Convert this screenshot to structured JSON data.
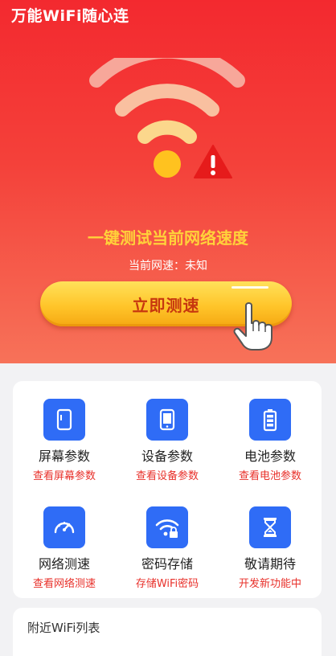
{
  "app": {
    "title": "万能WiFi随心连"
  },
  "hero": {
    "headline": "一键测试当前网络速度",
    "speed_line": "当前网速：未知",
    "test_button": "立即测速"
  },
  "features": [
    {
      "title": "屏幕参数",
      "sub": "查看屏幕参数",
      "icon": "phone-screen-icon"
    },
    {
      "title": "设备参数",
      "sub": "查看设备参数",
      "icon": "device-icon"
    },
    {
      "title": "电池参数",
      "sub": "查看电池参数",
      "icon": "battery-icon"
    },
    {
      "title": "网络测速",
      "sub": "查看网络测速",
      "icon": "speedometer-icon"
    },
    {
      "title": "密码存储",
      "sub": "存储WiFi密码",
      "icon": "wifi-lock-icon"
    },
    {
      "title": "敬请期待",
      "sub": "开发新功能中",
      "icon": "hourglass-icon"
    }
  ],
  "wifi_list": {
    "title": "附近WiFi列表"
  },
  "colors": {
    "accent_red": "#f3292f",
    "button_yellow": "#ffc52a",
    "icon_blue": "#2f6cf6",
    "sub_red": "#e8302a"
  }
}
